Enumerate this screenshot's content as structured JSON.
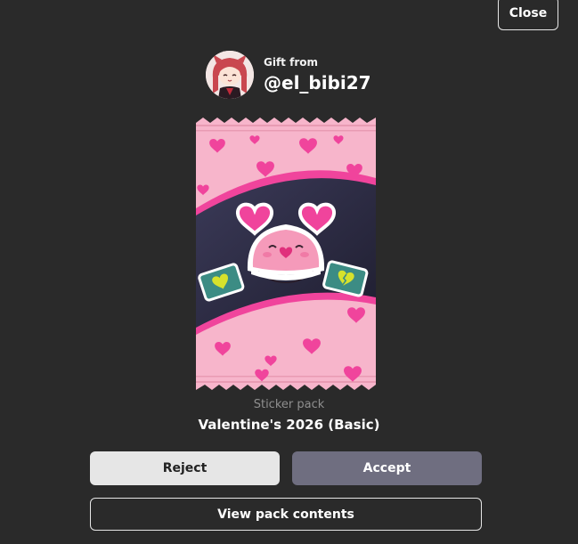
{
  "close_button": {
    "label": "Close"
  },
  "gift": {
    "from_label": "Gift from",
    "username": "@el_bibi27"
  },
  "pack": {
    "type_label": "Sticker pack",
    "name": "Valentine's 2026 (Basic)"
  },
  "actions": {
    "reject_label": "Reject",
    "accept_label": "Accept",
    "view_contents_label": "View pack contents"
  },
  "colors": {
    "background": "#2a2a2a",
    "accept_button": "#6f6e80",
    "reject_button": "#e6e6e6",
    "pack_pink": "#f7b5cb",
    "heart_pink": "#f0449c"
  }
}
